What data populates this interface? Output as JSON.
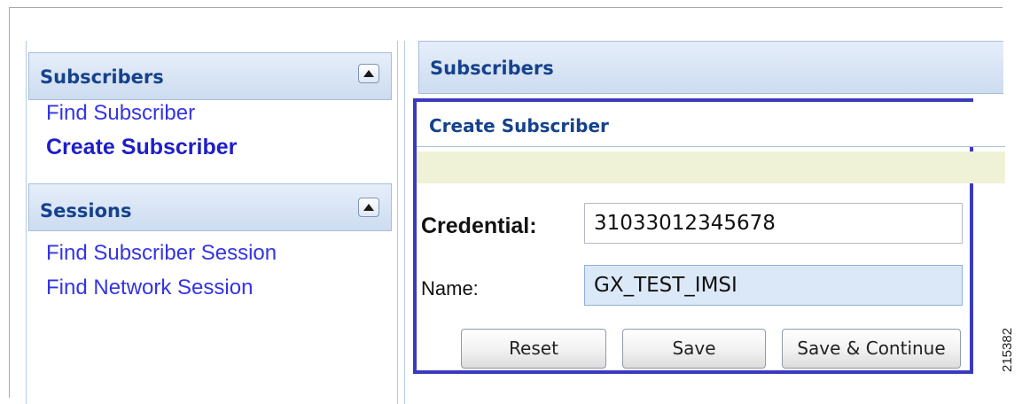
{
  "sidebar": {
    "subscribers_panel": {
      "title": "Subscribers",
      "links": [
        "Find Subscriber",
        "Create Subscriber"
      ]
    },
    "sessions_panel": {
      "title": "Sessions",
      "links": [
        "Find Subscriber Session",
        "Find Network Session"
      ]
    }
  },
  "main": {
    "header_title": "Subscribers",
    "form": {
      "title": "Create Subscriber",
      "credential_label": "Credential:",
      "credential_value": "31033012345678",
      "name_label": "Name:",
      "name_value": "GX_TEST_IMSI",
      "buttons": {
        "reset": "Reset",
        "save": "Save",
        "save_continue": "Save & Continue"
      }
    }
  },
  "figure_id": "215382",
  "colors": {
    "link": "#3434e6",
    "panel_title": "#15428b",
    "highlight_border": "#3a3abf",
    "message_strip": "#f0f2d7"
  }
}
